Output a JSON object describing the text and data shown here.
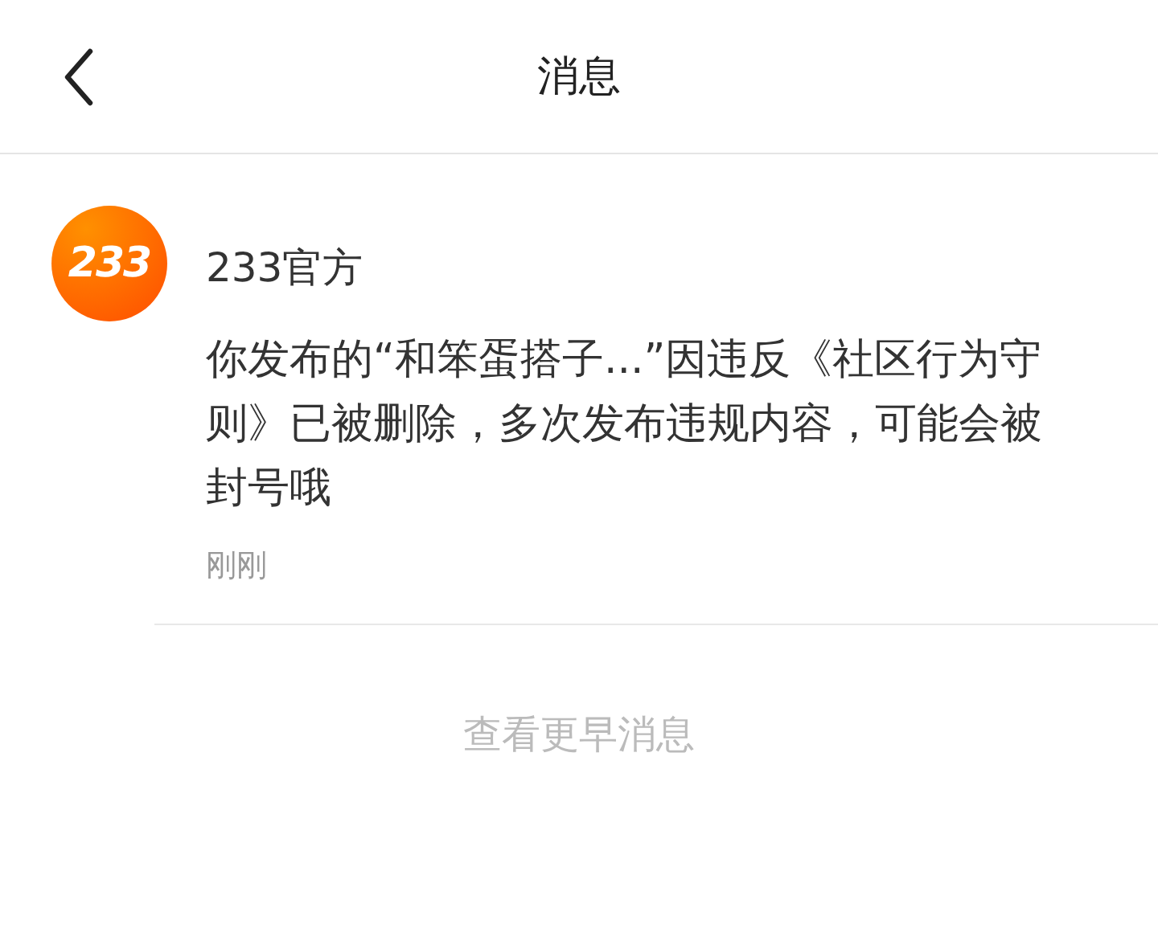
{
  "header": {
    "title": "消息"
  },
  "messages": [
    {
      "logo": "233",
      "sender": "233官方",
      "text": "你发布的“和笨蛋搭子...”因违反《社区行为守则》已被删除，多次发布违规内容，可能会被封号哦",
      "time": "刚刚"
    }
  ],
  "more_link": "查看更早消息"
}
